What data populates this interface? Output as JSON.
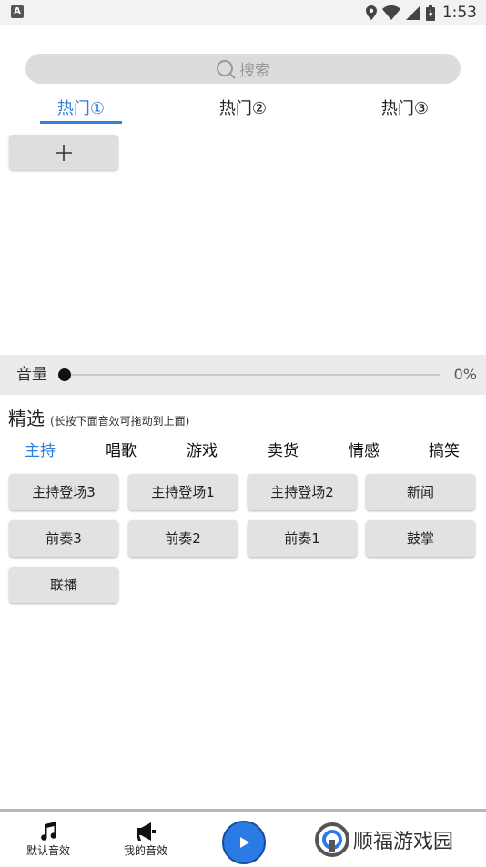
{
  "status_bar": {
    "time": "1:53",
    "left_badge": "A"
  },
  "search": {
    "placeholder": "搜索"
  },
  "tabs": [
    {
      "label": "热门①",
      "active": true
    },
    {
      "label": "热门②",
      "active": false
    },
    {
      "label": "热门③",
      "active": false
    }
  ],
  "add_button": {
    "icon": "plus-icon"
  },
  "volume": {
    "label": "音量",
    "value_text": "0%",
    "level": 0
  },
  "section": {
    "title": "精选",
    "hint": "(长按下面音效可拖动到上面)"
  },
  "categories": [
    {
      "label": "主持",
      "active": true
    },
    {
      "label": "唱歌"
    },
    {
      "label": "游戏"
    },
    {
      "label": "卖货"
    },
    {
      "label": "情感"
    },
    {
      "label": "搞笑"
    }
  ],
  "sounds": [
    "主持登场3",
    "主持登场1",
    "主持登场2",
    "新闻",
    "前奏3",
    "前奏2",
    "前奏1",
    "鼓掌",
    "联播"
  ],
  "bottom_nav": {
    "default_sounds": "默认音效",
    "my_sounds": "我的音效",
    "brand": "顺福游戏园"
  },
  "colors": {
    "accent": "#2f7fd6",
    "play": "#2c7be5"
  }
}
